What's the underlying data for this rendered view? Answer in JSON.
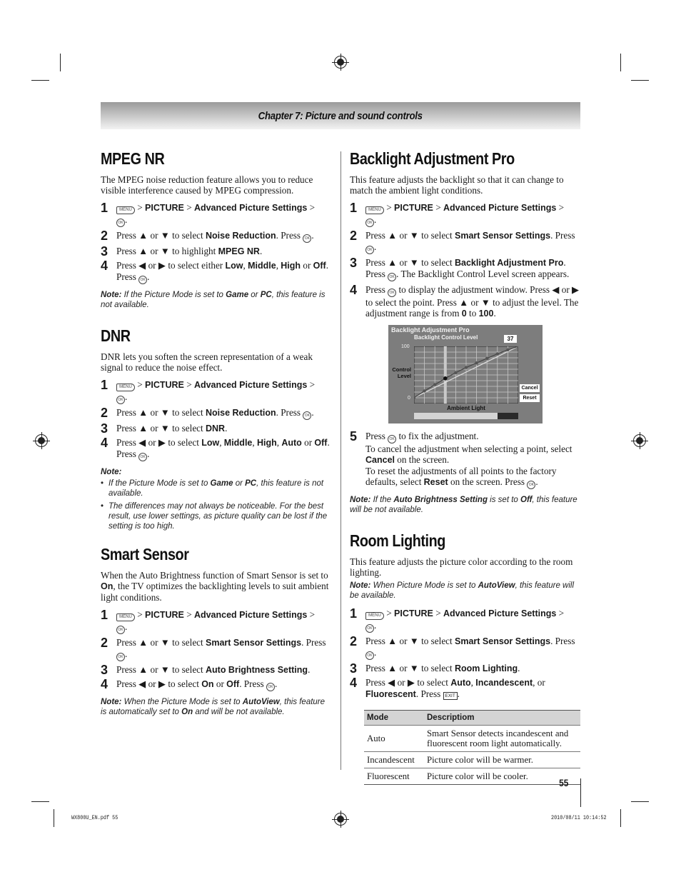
{
  "header": {
    "chapter": "Chapter 7: Picture and sound controls"
  },
  "icons": {
    "menu": "MENU",
    "ok": "OK",
    "exit": "EXIT"
  },
  "common": {
    "picture": "PICTURE",
    "advanced": "Advanced Picture Settings",
    "sep": " > ",
    "press": "Press ",
    "up_down": "▲ or ▼",
    "left_right": "◀ or ▶",
    "period": "."
  },
  "mpeg": {
    "title": "MPEG NR",
    "intro": "The MPEG noise reduction feature allows you to reduce visible interference caused by MPEG compression.",
    "step2_pre": " to select ",
    "step2_b": "Noise Reduction",
    "step2_post": ". Press ",
    "step3_pre": " to highlight ",
    "step3_b": "MPEG NR",
    "step4_pre": " to select either ",
    "step4_b1": "Low",
    "step4_b2": "Middle",
    "step4_b3": "High",
    "step4_or": " or ",
    "step4_b4": "Off",
    "step4_post": ". Press ",
    "note_label": "Note:",
    "note_pre": " If the Picture Mode is set to ",
    "note_b1": "Game",
    "note_or": " or ",
    "note_b2": "PC",
    "note_post": ", this feature is not available."
  },
  "dnr": {
    "title": "DNR",
    "intro": "DNR lets you soften the screen representation of a weak signal to reduce the noise effect.",
    "step2_pre": " to select ",
    "step2_b": "Noise Reduction",
    "step2_post": ". Press ",
    "step3_pre": " to select ",
    "step3_b": "DNR",
    "step4_pre": " to select ",
    "step4_b1": "Low",
    "step4_b2": "Middle",
    "step4_b3": "High",
    "step4_b4": "Auto",
    "step4_or": " or ",
    "step4_b5": "Off",
    "step4_post": ". Press ",
    "note_label": "Note:",
    "note1_pre": "If the Picture Mode is set to ",
    "note1_b1": "Game",
    "note1_or": " or ",
    "note1_b2": "PC",
    "note1_post": ", this feature is not available.",
    "note2": "The differences may not always be noticeable. For the best result, use lower settings, as picture quality can be lost if the setting is too high."
  },
  "smart": {
    "title": "Smart Sensor",
    "intro_pre": "When the Auto Brightness function of Smart Sensor is set to ",
    "intro_b": "On",
    "intro_post": ", the TV optimizes the backlighting levels to suit ambient light conditions.",
    "step2_pre": " to select ",
    "step2_b": "Smart Sensor Settings",
    "step2_post": ". Press ",
    "step3_pre": " to select ",
    "step3_b": "Auto Brightness Setting",
    "step4_pre": " to select ",
    "step4_b1": "On",
    "step4_or": " or ",
    "step4_b2": "Off",
    "step4_post": ". Press ",
    "note_label": "Note:",
    "note_pre": " When the Picture Mode is set to ",
    "note_b1": "AutoView",
    "note_mid": ", this feature is automatically set to ",
    "note_b2": "On",
    "note_post": " and will be not available."
  },
  "backlight": {
    "title": "Backlight Adjustment Pro",
    "intro": "This feature adjusts the backlight so that it can change to match the ambient light conditions.",
    "step2_pre": " to select ",
    "step2_b": "Smart Sensor Settings",
    "step2_post": ". Press ",
    "step3_pre": " to select ",
    "step3_b": "Backlight Adjustment Pro",
    "step3_post": ". The Backlight Control Level screen appears.",
    "step4_a": " to display the adjustment window. Press ",
    "step4_b": " to select the point. Press ",
    "step4_c": " to adjust the level. The adjustment range is from ",
    "step4_b1": "0",
    "step4_to": " to ",
    "step4_b2": "100",
    "step5_a": " to fix the adjustment.",
    "step5_b": "To cancel the adjustment when selecting a point, select ",
    "step5_b_b": "Cancel",
    "step5_b_post": " on the screen.",
    "step5_c": "To reset the adjustments of all points to the factory defaults, select ",
    "step5_c_b": "Reset",
    "step5_c_post": " on the screen. Press ",
    "note_label": "Note:",
    "note_pre": " If the ",
    "note_b1": "Auto Brightness Setting",
    "note_mid": " is set to ",
    "note_b2": "Off",
    "note_post": ", this feature will be not available.",
    "screen": {
      "title": "Backlight Adjustment Pro",
      "subtitle": "Backlight Control Level",
      "value": "37",
      "y_label_1": "Control",
      "y_label_2": "Level",
      "y_max": "100",
      "y_min": "0",
      "x_label": "Ambient Light",
      "cancel": "Cancel",
      "reset": "Reset",
      "ambient_fill_fraction": 0.8,
      "selected_index": 3,
      "points": [
        10,
        22,
        33,
        44,
        54,
        63,
        71,
        79,
        87,
        94,
        100
      ],
      "default_points": [
        10,
        19,
        28,
        37,
        46,
        55,
        64,
        73,
        82,
        91,
        100
      ]
    }
  },
  "room": {
    "title": "Room Lighting",
    "intro": "This feature adjusts the picture color according to the room lighting.",
    "note_label": "Note:",
    "note_pre": " When Picture Mode is set to ",
    "note_b": "AutoView",
    "note_post": ", this feature will be available.",
    "step2_pre": " to select ",
    "step2_b": "Smart Sensor Settings",
    "step2_post": ". Press ",
    "step3_pre": " to select ",
    "step3_b": "Room Lighting",
    "step4_pre": " to select ",
    "step4_b1": "Auto",
    "step4_b2": "Incandescent",
    "step4_or": ", or ",
    "step4_b3": "Fluorescent",
    "step4_post": ". Press ",
    "table": {
      "headers": [
        "Mode",
        "Descriptiom"
      ],
      "rows": [
        [
          "Auto",
          "Smart Sensor detects incandescent and fluorescent room light automatically."
        ],
        [
          "Incandescent",
          "Picture color will be warmer."
        ],
        [
          "Fluorescent",
          "Picture color will be cooler."
        ]
      ]
    }
  },
  "footer": {
    "page_number": "55",
    "file": "WX800U_EN.pdf   55",
    "timestamp": "2010/08/11   10:14:52"
  }
}
